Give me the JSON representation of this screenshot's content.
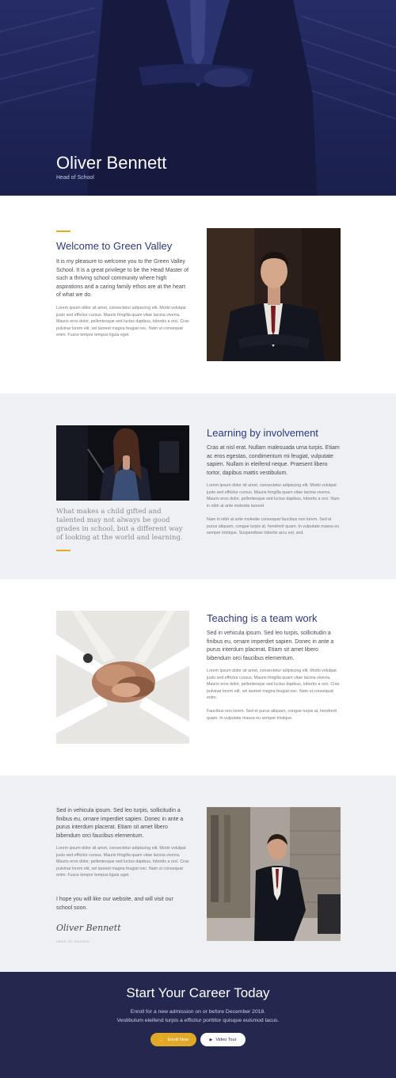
{
  "hero": {
    "name": "Oliver Bennett",
    "role": "Head of School",
    "overlay_color": "#1f2559"
  },
  "welcome": {
    "heading": "Welcome to Green Valley",
    "lead": "It is my pleasure to welcome you to the Green Valley School. It is a great privilege to be the Head Master of such a thriving school community where high aspirations and a caring family ethos are at the heart of what we do.",
    "body": "Lorem ipsum dolor sit amet, consectetur adipiscing elit. Morbi volutpat justo sed efficitur cursus. Mauris fringilla quam vitae lacinia viverra. Mauris eros dolor, pellentesque sed luctus dapibus, lobortis a orci. Cras pulvinar lorem elit, vel laoreet magna feugiat nec. Nam ut consequat enim. Fusce tempor tempus ligula eget."
  },
  "learning": {
    "heading": "Learning by involvement",
    "lead": "Cras at nisl erat. Nullam malesuada urna turpis. Etiam ac eros egestas, condimentum mi feugiat, vulputate sapien. Nullam in eleifend neque. Praesent libero tortor, dapibus mattis vestibulum.",
    "body1": "Lorem ipsum dolor sit amet, consectetur adipiscing elit. Morbi volutpat justo sed efficitur cursus. Mauris fringilla quam vitae lacinia viverra. Mauris eros dolor, pellentesque sed luctus dapibus, lobortis a orci. Nam in nibh at ante molestie laoreet",
    "body2": "Nam in nibh at ante molestie consequat faucibus non lorem. Sed et purus aliquam, congue turpis at, hendrerit quam. In vulputate massa eu semper tristique. Suspendisse lobortis arcu est, sed.",
    "quote": "What makes a child gifted and talented may not always be good grades in school, but a different way of looking at the world and learning."
  },
  "teamwork": {
    "heading": "Teaching is a team work",
    "lead": "Sed in vehicula ipsum. Sed leo turpis, sollicitudin a finibus eu, ornare imperdiet sapien. Donec in ante a purus interdum placerat. Etiam sit amet libero bibendum orci faucibus elementum.",
    "body1": "Lorem ipsum dolor sit amet, consectetur adipiscing elit. Morbi volutpat justo sed efficitur cursus. Mauris fringilla quam vitae lacinia viverra. Mauris eros dolor, pellentesque sed luctus dapibus, lobortis a orci. Cras pulvinar lorem elit, vel laoreet magna feugiat nec. Nam ut consequat enim.",
    "body2": "Faucibus non lorem. Sed et purus aliquam, congue turpis at, hendrerit quam. In vulputate massa eu semper tristique."
  },
  "closing": {
    "lead": "Sed in vehicula ipsum. Sed leo turpis, sollicitudin a finibus eu, ornare imperdiet sapien. Donec in ante a purus interdum placerat. Etiam sit amet libero bibendum orci faucibus elementum.",
    "body": "Lorem ipsum dolor sit amet, consectetur adipiscing elit. Morbi volutpat justo sed efficitur cursus. Mauris fringilla quam vitae lacinia viverra. Mauris eros dolor, pellentesque sed luctus dapibus, lobortis a orci. Cras pulvinar lorem elit, vel laoreet magna feugiat nec. Nam ut consequat enim. Fusce tempor tempus ligula eget.",
    "outro": "I hope you will like our website, and will visit our school soon.",
    "signature": "Oliver Bennett",
    "signature_caption": "HEAD OF SCHOOL"
  },
  "cta": {
    "title": "Start Your Career Today",
    "line1": "Enroll for a new admission on or before December 2018.",
    "line2": "Vestibulum eleifend turpis a efficitur porttitor quisque euismod lacus.",
    "enroll_label": "Enroll Now",
    "tour_label": "Video Tour",
    "accent": "#e0a92a",
    "background": "#24284f"
  },
  "icons": {
    "enroll": "hand-pointer-icon",
    "tour": "play-icon"
  }
}
